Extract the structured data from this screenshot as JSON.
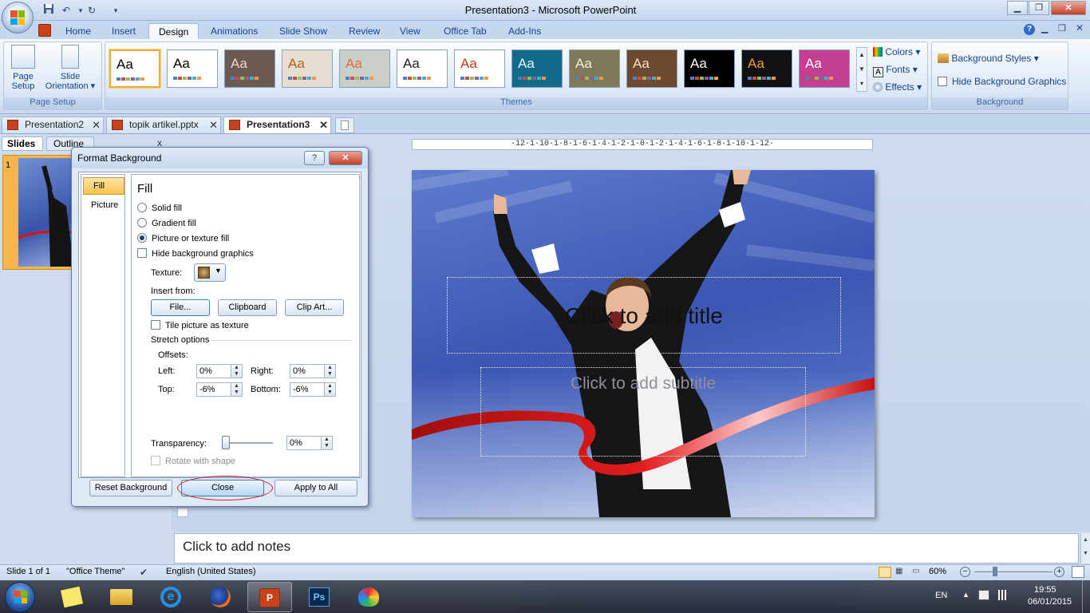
{
  "window": {
    "title": "Presentation3 - Microsoft PowerPoint",
    "min_glyph": "▁",
    "max_glyph": "❐",
    "close_glyph": "✕"
  },
  "ribbon": {
    "tabs": [
      "Home",
      "Insert",
      "Design",
      "Animations",
      "Slide Show",
      "Review",
      "View",
      "Office Tab",
      "Add-Ins"
    ],
    "active_tab": "Design",
    "page_setup": {
      "group_label": "Page Setup",
      "page_setup_line1": "Page",
      "page_setup_line2": "Setup",
      "orientation_line1": "Slide",
      "orientation_line2": "Orientation ▾"
    },
    "themes": {
      "group_label": "Themes",
      "sample_text": "Aa",
      "items": [
        {
          "bg": "#ffffff",
          "fg": "#000000",
          "sel": true
        },
        {
          "bg": "#ffffff",
          "fg": "#000000"
        },
        {
          "bg": "#6b5a52",
          "fg": "#e8d9cc"
        },
        {
          "bg": "#e7ded3",
          "fg": "#c05a1c"
        },
        {
          "bg": "#c8cfc9",
          "fg": "#e06b3c"
        },
        {
          "bg": "#ffffff",
          "fg": "#222222"
        },
        {
          "bg": "#ffffff",
          "fg": "#c93a12"
        },
        {
          "bg": "#136b8a",
          "fg": "#e8f4ff"
        },
        {
          "bg": "#7f7a5a",
          "fg": "#f4eecf"
        },
        {
          "bg": "#6e4932",
          "fg": "#f5e2c8"
        },
        {
          "bg": "#000000",
          "fg": "#ffffff"
        },
        {
          "bg": "#111111",
          "fg": "#f0a030"
        },
        {
          "bg": "#c43f8f",
          "fg": "#ffffff"
        }
      ],
      "colors": "Colors ▾",
      "fonts": "Fonts ▾",
      "effects": "Effects ▾"
    },
    "background": {
      "group_label": "Background",
      "styles": "Background Styles ▾",
      "hide_graphics": "Hide Background Graphics"
    }
  },
  "doc_tabs": [
    {
      "label": "Presentation2",
      "active": false
    },
    {
      "label": "topik artikel.pptx",
      "active": false
    },
    {
      "label": "Presentation3",
      "active": true
    }
  ],
  "doc_tab_close": "✕",
  "left_pane": {
    "slides_tab": "Slides",
    "outline_tab": "Outline",
    "close": "x",
    "slide_number": "1"
  },
  "ruler_text": "·12·1·10·1·8·1·6·1·4·1·2·1·0·1·2·1·4·1·6·1·8·1·10·1·12·",
  "slide": {
    "title_placeholder": "Click to add title",
    "subtitle_placeholder": "Click to add subtitle"
  },
  "notes_placeholder": "Click to add notes",
  "dialog": {
    "title": "Format Background",
    "help": "?",
    "close": "✕",
    "nav": [
      "Fill",
      "Picture"
    ],
    "heading": "Fill",
    "options": {
      "solid": "Solid fill",
      "gradient": "Gradient fill",
      "picture": "Picture or texture fill",
      "hide_bg": "Hide background graphics"
    },
    "texture_label": "Texture:",
    "insert_from": "Insert from:",
    "file_btn": "File...",
    "clipboard_btn": "Clipboard",
    "clipart_btn": "Clip Art...",
    "tile": "Tile picture as texture",
    "stretch": "Stretch options",
    "offsets": "Offsets:",
    "left_label": "Left:",
    "left_val": "0%",
    "right_label": "Right:",
    "right_val": "0%",
    "top_label": "Top:",
    "top_val": "-6%",
    "bottom_label": "Bottom:",
    "bottom_val": "-6%",
    "transparency_label": "Transparency:",
    "transparency_val": "0%",
    "rotate": "Rotate with shape",
    "reset_btn": "Reset Background",
    "close_btn": "Close",
    "apply_btn": "Apply to All"
  },
  "status": {
    "slide_info": "Slide 1 of 1",
    "theme": "\"Office Theme\"",
    "language": "English (United States)",
    "zoom": "60%"
  },
  "taskbar": {
    "lang": "EN",
    "time": "19:55",
    "date": "06/01/2015"
  },
  "colors": {
    "accent_orange": "#f7c24b",
    "ribbon_blue": "#c5d7ee"
  }
}
